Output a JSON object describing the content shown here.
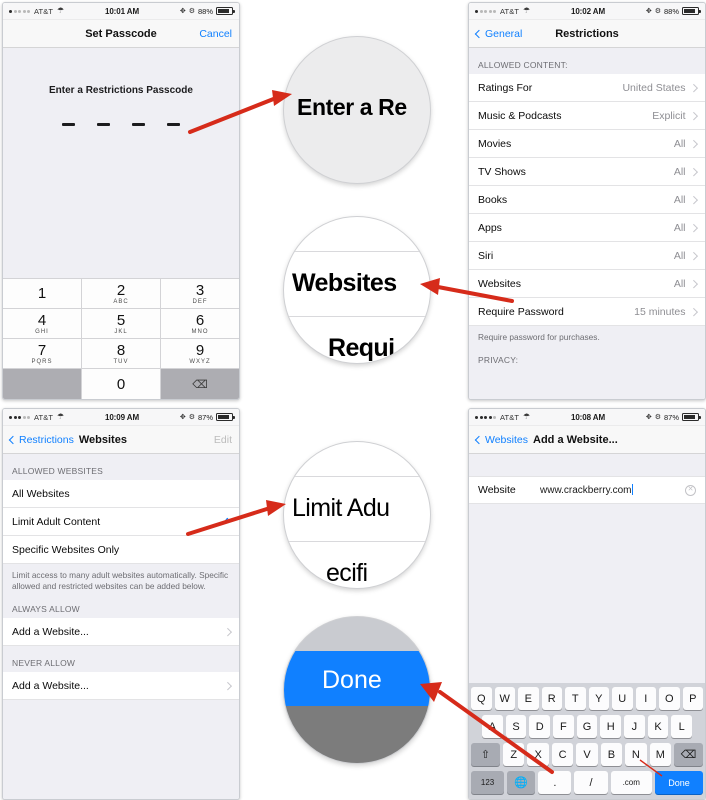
{
  "panels": {
    "set_passcode": {
      "status": {
        "carrier": "AT&T",
        "time": "10:01 AM",
        "battery": "88%"
      },
      "nav": {
        "title": "Set Passcode",
        "right_action": "Cancel"
      },
      "prompt": "Enter a Restrictions Passcode",
      "keypad": [
        {
          "num": "1",
          "alpha": ""
        },
        {
          "num": "2",
          "alpha": "ABC"
        },
        {
          "num": "3",
          "alpha": "DEF"
        },
        {
          "num": "4",
          "alpha": "GHI"
        },
        {
          "num": "5",
          "alpha": "JKL"
        },
        {
          "num": "6",
          "alpha": "MNO"
        },
        {
          "num": "7",
          "alpha": "PQRS"
        },
        {
          "num": "8",
          "alpha": "TUV"
        },
        {
          "num": "9",
          "alpha": "WXYZ"
        },
        {
          "num": "0",
          "alpha": ""
        }
      ],
      "delete_icon": "⌫"
    },
    "restrictions": {
      "status": {
        "carrier": "AT&T",
        "time": "10:02 AM",
        "battery": "88%"
      },
      "nav": {
        "back": "General",
        "title": "Restrictions"
      },
      "section_header": "ALLOWED CONTENT:",
      "rows": [
        {
          "label": "Ratings For",
          "value": "United States"
        },
        {
          "label": "Music & Podcasts",
          "value": "Explicit"
        },
        {
          "label": "Movies",
          "value": "All"
        },
        {
          "label": "TV Shows",
          "value": "All"
        },
        {
          "label": "Books",
          "value": "All"
        },
        {
          "label": "Apps",
          "value": "All"
        },
        {
          "label": "Siri",
          "value": "All"
        },
        {
          "label": "Websites",
          "value": "All"
        },
        {
          "label": "Require Password",
          "value": "15 minutes"
        }
      ],
      "footnote": "Require password for purchases.",
      "privacy_header": "PRIVACY:"
    },
    "websites": {
      "status": {
        "carrier": "AT&T",
        "time": "10:09 AM",
        "battery": "87%"
      },
      "nav": {
        "back": "Restrictions",
        "title": "Websites",
        "right_action": "Edit"
      },
      "allowed_header": "ALLOWED WEBSITES",
      "options": [
        {
          "label": "All Websites",
          "checked": false
        },
        {
          "label": "Limit Adult Content",
          "checked": true
        },
        {
          "label": "Specific Websites Only",
          "checked": false
        }
      ],
      "footnote": "Limit access to many adult websites automatically. Specific allowed and restricted websites can be added below.",
      "always_allow_header": "ALWAYS ALLOW",
      "always_allow_row": "Add a Website...",
      "never_allow_header": "NEVER ALLOW",
      "never_allow_row": "Add a Website..."
    },
    "add_website": {
      "status": {
        "carrier": "AT&T",
        "time": "10:08 AM",
        "battery": "87%"
      },
      "nav": {
        "back": "Websites",
        "title": "Add a Website..."
      },
      "field": {
        "label": "Website",
        "value": "www.crackberry.com"
      },
      "keyboard": {
        "row1": [
          "Q",
          "W",
          "E",
          "R",
          "T",
          "Y",
          "U",
          "I",
          "O",
          "P"
        ],
        "row2": [
          "A",
          "S",
          "D",
          "F",
          "G",
          "H",
          "J",
          "K",
          "L"
        ],
        "row3_shift": "⇧",
        "row3": [
          "Z",
          "X",
          "C",
          "V",
          "B",
          "N",
          "M"
        ],
        "row3_delete": "⌫",
        "row4_numbers": "123",
        "row4_globe": "globe-icon",
        "row4_period": ".",
        "row4_slash": "/",
        "row4_dotcom": ".com",
        "row4_done": "Done"
      }
    }
  },
  "magnifiers": [
    {
      "name": "enter-restrictions-passcode",
      "text": "Enter a Re"
    },
    {
      "name": "websites-row",
      "text": "Websites",
      "below": "Requi"
    },
    {
      "name": "limit-adult-content",
      "text": "Limit Adu",
      "below": "ecifi"
    },
    {
      "name": "done-key",
      "text": "Done"
    }
  ],
  "colors": {
    "accent_blue": "#1080ff",
    "arrow_red": "#d62b1a",
    "list_bg": "#efeff4",
    "keyboard_bg": "#d1d3d9"
  }
}
